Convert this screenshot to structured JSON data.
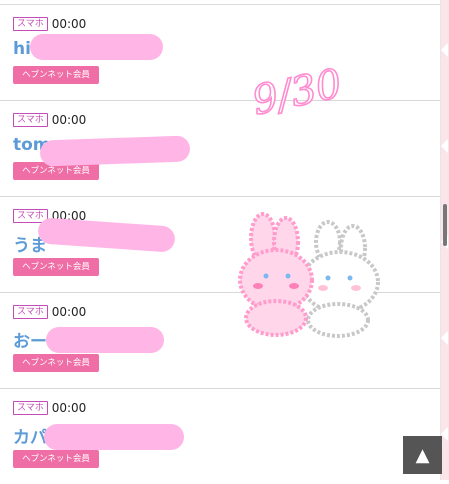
{
  "rows": [
    {
      "device": "スマホ",
      "time": "00:00",
      "name": "hi",
      "badge": "ヘブンネット会員"
    },
    {
      "device": "スマホ",
      "time": "00:00",
      "name": "tom",
      "badge": "ヘブンネット会員"
    },
    {
      "device": "スマホ",
      "time": "00:00",
      "name": "うま",
      "badge": "ヘブンネット会員"
    },
    {
      "device": "スマホ",
      "time": "00:00",
      "name": "おー",
      "badge": "ヘブンネット会員"
    },
    {
      "device": "スマホ",
      "time": "00:00",
      "name": "カパ",
      "badge": "ヘブンネット会員"
    }
  ],
  "sticker": {
    "date": "9/30"
  },
  "controls": {
    "scroll_top_icon": "up-triangle-icon",
    "scroll_top_glyph": "▲"
  },
  "colors": {
    "accent_pink": "#f06ea6",
    "device_border": "#c44bb8",
    "name_blue": "#5c9bd6",
    "redaction": "#ffb6e6"
  }
}
